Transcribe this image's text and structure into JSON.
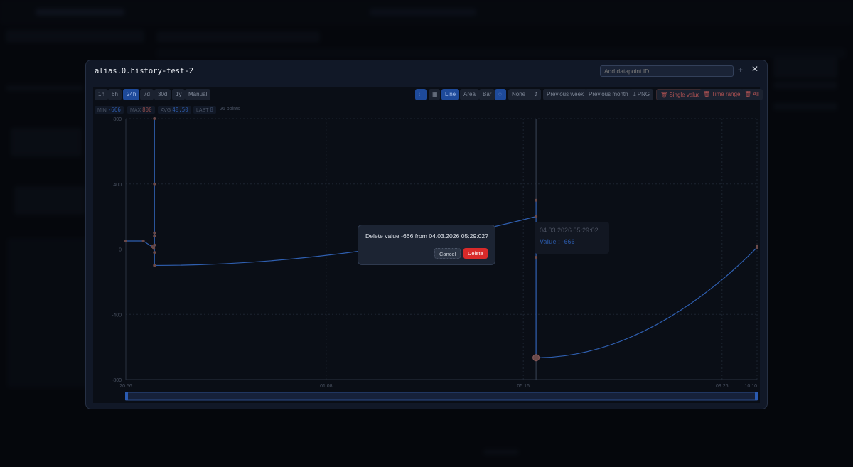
{
  "modal": {
    "title": "alias.0.history-test-2",
    "add_placeholder": "Add datapoint ID...",
    "add_icon": "plus-icon",
    "close_icon": "close-icon"
  },
  "ranges": [
    "1h",
    "6h",
    "24h",
    "7d",
    "30d",
    "1y",
    "Manual"
  ],
  "active_range": "24h",
  "toolbar": {
    "line": "Line",
    "area": "Area",
    "bar": "Bar",
    "aggregate": "None",
    "prev_week": "Previous week",
    "prev_month": "Previous month",
    "png": "PNG",
    "single": "Single value",
    "range": "Time range",
    "all": "All"
  },
  "stats": {
    "min_label": "MIN",
    "min": "-666",
    "max_label": "MAX",
    "max": "800",
    "avg_label": "AVG",
    "avg": "48.50",
    "last_label": "LAST",
    "last": "8",
    "points": "26 points"
  },
  "tooltip": {
    "time": "04.03.2026 05:29:02",
    "value": "Value : -666"
  },
  "confirm": {
    "question": "Delete value -666 from 04.03.2026 05:29:02?",
    "cancel": "Cancel",
    "delete": "Delete"
  },
  "colors": {
    "line": "#2f5fb0",
    "point": "#6b4a4a",
    "accent": "#1e4a9a",
    "danger": "#d92a2a"
  },
  "chart_data": {
    "type": "line",
    "xlabel": "",
    "ylabel": "",
    "ylim": [
      -800,
      800
    ],
    "yticks": [
      800,
      400,
      0,
      -400,
      -800
    ],
    "xlim_minutes": [
      0,
      794
    ],
    "xticks": [
      {
        "m": 0,
        "label": "20:56"
      },
      {
        "m": 252,
        "label": "01:08"
      },
      {
        "m": 500,
        "label": "05:16"
      },
      {
        "m": 750,
        "label": "09:26"
      },
      {
        "m": 794,
        "label": "10:10"
      }
    ],
    "x_unit": "minutes since 20:56",
    "points": [
      [
        0,
        50
      ],
      [
        22,
        50
      ],
      [
        33,
        15
      ],
      [
        35,
        5
      ],
      [
        36,
        25
      ],
      [
        36,
        800
      ],
      [
        36,
        400
      ],
      [
        36,
        100
      ],
      [
        36,
        80
      ],
      [
        36,
        -20
      ],
      [
        36,
        -100
      ],
      [
        516,
        200
      ],
      [
        516,
        300
      ],
      [
        516,
        -50
      ],
      [
        516,
        -666
      ],
      [
        794,
        10
      ],
      [
        794,
        20
      ]
    ],
    "highlight": [
      516,
      -666
    ]
  }
}
